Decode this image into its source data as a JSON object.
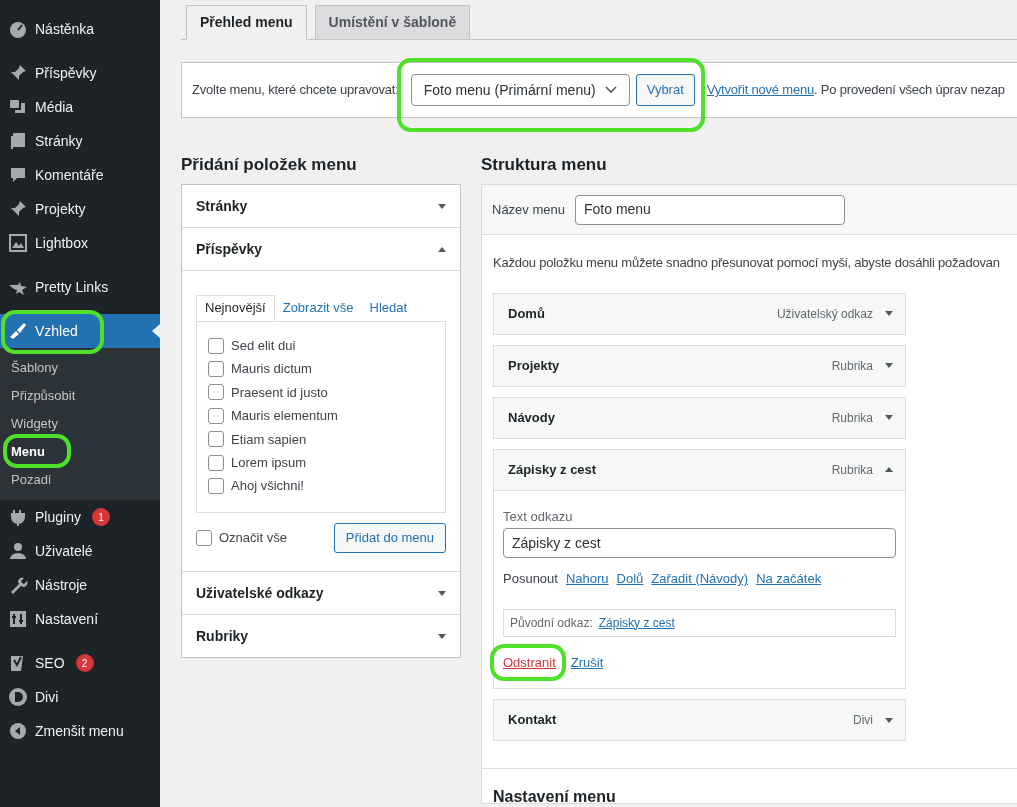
{
  "sidebar": {
    "groups": [
      [
        {
          "label": "Nástěnka",
          "selected": false,
          "highlighted": false
        }
      ],
      [
        {
          "label": "Příspěvky",
          "selected": false,
          "highlighted": false
        },
        {
          "label": "Média",
          "selected": false,
          "highlighted": false
        },
        {
          "label": "Stránky",
          "selected": false,
          "highlighted": false
        },
        {
          "label": "Komentáře",
          "selected": false,
          "highlighted": false
        },
        {
          "label": "Projekty",
          "selected": false,
          "highlighted": false
        },
        {
          "label": "Lightbox",
          "selected": false,
          "highlighted": false
        }
      ],
      [
        {
          "label": "Pretty Links",
          "selected": false,
          "highlighted": false
        }
      ],
      [
        {
          "label": "Vzhled",
          "selected": true,
          "highlighted": true,
          "children": [
            {
              "label": "Šablony",
              "selected": false,
              "highlighted": false
            },
            {
              "label": "Přizpůsobit",
              "selected": false,
              "highlighted": false
            },
            {
              "label": "Widgety",
              "selected": false,
              "highlighted": false
            },
            {
              "label": "Menu",
              "selected": true,
              "highlighted": true
            },
            {
              "label": "Pozadí",
              "selected": false,
              "highlighted": false
            }
          ]
        },
        {
          "label": "Pluginy",
          "selected": false,
          "highlighted": false,
          "badge": "1"
        },
        {
          "label": "Uživatelé",
          "selected": false,
          "highlighted": false
        },
        {
          "label": "Nástroje",
          "selected": false,
          "highlighted": false
        },
        {
          "label": "Nastavení",
          "selected": false,
          "highlighted": false
        }
      ],
      [
        {
          "label": "SEO",
          "selected": false,
          "highlighted": false,
          "badge": "2"
        },
        {
          "label": "Divi",
          "selected": false,
          "highlighted": false
        },
        {
          "label": "Zmenšit menu",
          "selected": false,
          "highlighted": false
        }
      ]
    ]
  },
  "tabs": [
    {
      "label": "Přehled menu",
      "selected": true
    },
    {
      "label": "Umístění v šabloně",
      "selected": false
    }
  ],
  "menu_select": {
    "label": "Zvolte menu, které chcete upravovat:",
    "value": "Foto menu (Primární menu)",
    "button": "Vybrat",
    "highlighted": true,
    "create_link": "Vytvořit nové menu",
    "hint": ". Po provedení všech úprav nezap"
  },
  "add_items": {
    "title": "Přidání položek menu",
    "sections": [
      {
        "title": "Stránky",
        "expanded": false
      },
      {
        "title": "Příspěvky",
        "expanded": true,
        "tabs": [
          {
            "label": "Nejnovější",
            "selected": true
          },
          {
            "label": "Zobrazit vše",
            "selected": false
          },
          {
            "label": "Hledat",
            "selected": false
          }
        ],
        "items": [
          {
            "label": "Sed elit dui",
            "checked": false
          },
          {
            "label": "Mauris dictum",
            "checked": false
          },
          {
            "label": "Praesent id justo",
            "checked": false
          },
          {
            "label": "Mauris elementum",
            "checked": false
          },
          {
            "label": "Etiam sapien",
            "checked": false
          },
          {
            "label": "Lorem ipsum",
            "checked": false
          },
          {
            "label": "Ahoj všichni!",
            "checked": false
          }
        ],
        "select_all": {
          "label": "Označit vše",
          "checked": false
        },
        "button": "Přidat do menu"
      },
      {
        "title": "Uživatelské odkazy",
        "expanded": false
      },
      {
        "title": "Rubriky",
        "expanded": false
      }
    ]
  },
  "structure": {
    "title": "Struktura menu",
    "name_label": "Název menu",
    "name_value": "Foto menu",
    "instructions": "Každou položku menu můžete snadno přesunovat pomocí myši, abyste dosáhli požadovan",
    "items": [
      {
        "title": "Domů",
        "type": "Uživatelský odkaz",
        "expanded": false
      },
      {
        "title": "Projekty",
        "type": "Rubrika",
        "expanded": false
      },
      {
        "title": "Návody",
        "type": "Rubrika",
        "expanded": false
      },
      {
        "title": "Zápisky z cest",
        "type": "Rubrika",
        "expanded": true,
        "link_text_label": "Text odkazu",
        "link_text_value": "Zápisky z cest",
        "move_label": "Posunout",
        "move_links": [
          "Nahoru",
          "Dolů",
          "Zařadit (Návody)",
          "Na začátek"
        ],
        "original_label": "Původní odkaz:",
        "original_link": "Zápisky z cest",
        "remove": {
          "label": "Odstranit",
          "highlighted": true
        },
        "cancel": "Zrušit"
      },
      {
        "title": "Kontakt",
        "type": "Divi",
        "expanded": false
      }
    ],
    "settings_title": "Nastavení menu"
  }
}
